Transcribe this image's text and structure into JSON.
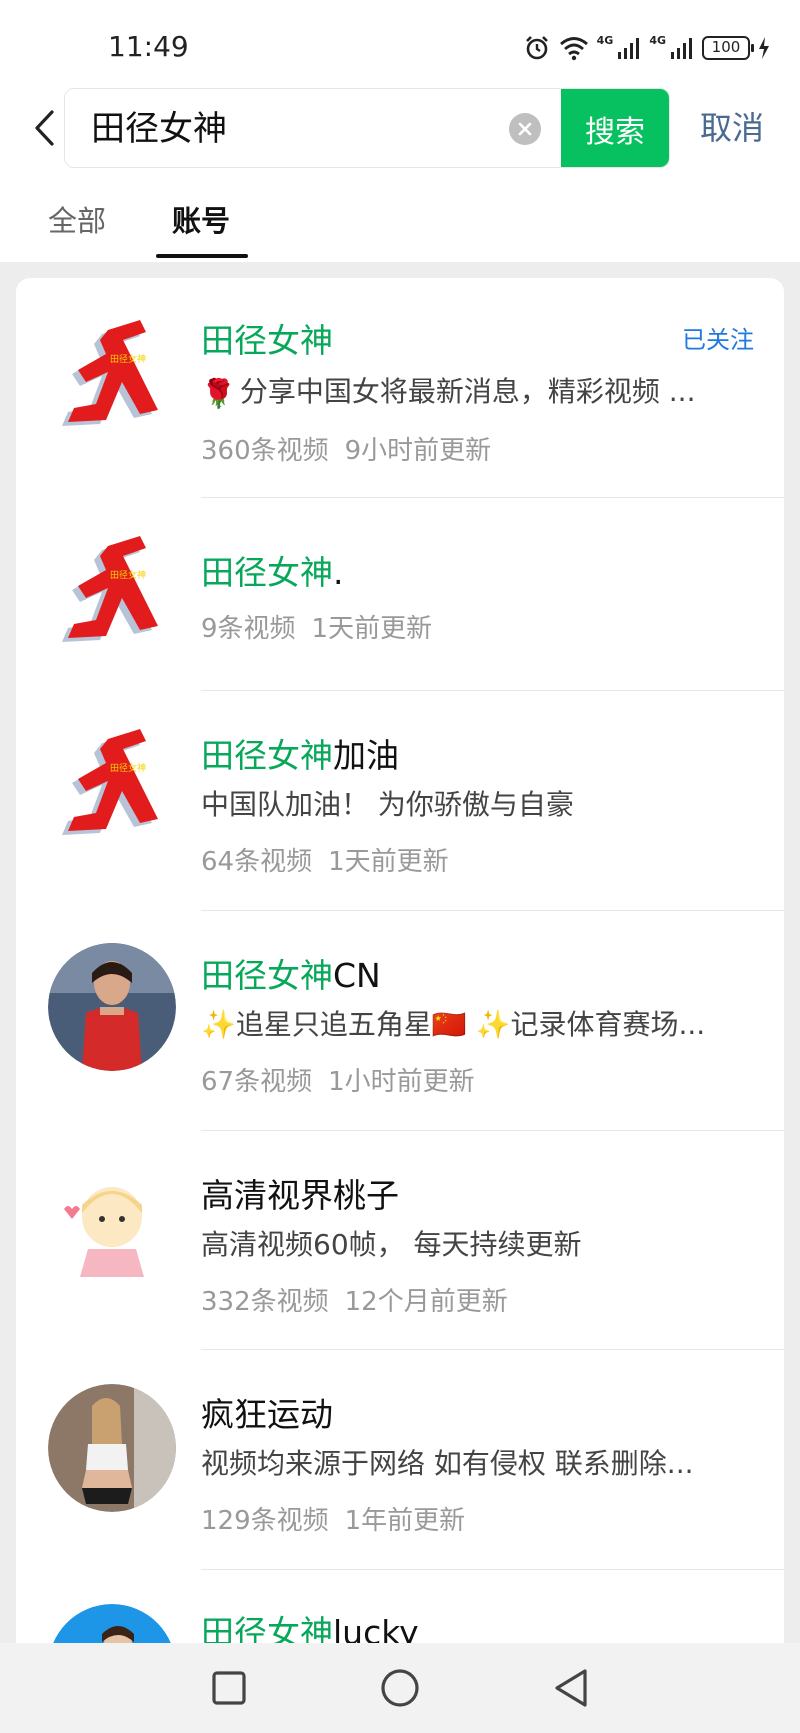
{
  "status_bar": {
    "time": "11:49",
    "network_1": "4G",
    "network_2": "4G",
    "battery": "100"
  },
  "search": {
    "query": "田径女神",
    "search_label": "搜索",
    "cancel_label": "取消"
  },
  "tabs": [
    {
      "label": "全部",
      "active": false
    },
    {
      "label": "账号",
      "active": true
    }
  ],
  "results": [
    {
      "title_match": "田径女神",
      "title_rest": "",
      "follow_label": "已关注",
      "desc_emoji": "🌹",
      "desc": "分享中国女将最新消息，精彩视频 ...",
      "videos": "360条视频",
      "updated": "9小时前更新"
    },
    {
      "title_match": "田径女神",
      "title_rest": ".",
      "desc": "",
      "videos": "9条视频",
      "updated": "1天前更新"
    },
    {
      "title_match": "田径女神",
      "title_rest": "加油",
      "desc": "中国队加油！ 为你骄傲与自豪",
      "videos": "64条视频",
      "updated": "1天前更新"
    },
    {
      "title_match": "田径女神",
      "title_rest": "CN",
      "desc": "✨追星只追五角星🇨🇳 ✨记录体育赛场...",
      "videos": "67条视频",
      "updated": "1小时前更新"
    },
    {
      "title_match": "",
      "title_rest": "高清视界桃子",
      "desc": "高清视频60帧， 每天持续更新",
      "videos": "332条视频",
      "updated": "12个月前更新"
    },
    {
      "title_match": "",
      "title_rest": "疯狂运动",
      "desc": "视频均来源于网络 如有侵权 联系删除...",
      "videos": "129条视频",
      "updated": "1年前更新"
    },
    {
      "title_match": "田径女神",
      "title_rest": "lucky"
    }
  ],
  "avatar_logo_text": "田径女神",
  "colors": {
    "accent_green": "#07c160",
    "highlight_green": "#07a85a",
    "follow_blue": "#1f7ae0",
    "cancel_blue": "#4b6a8f"
  }
}
